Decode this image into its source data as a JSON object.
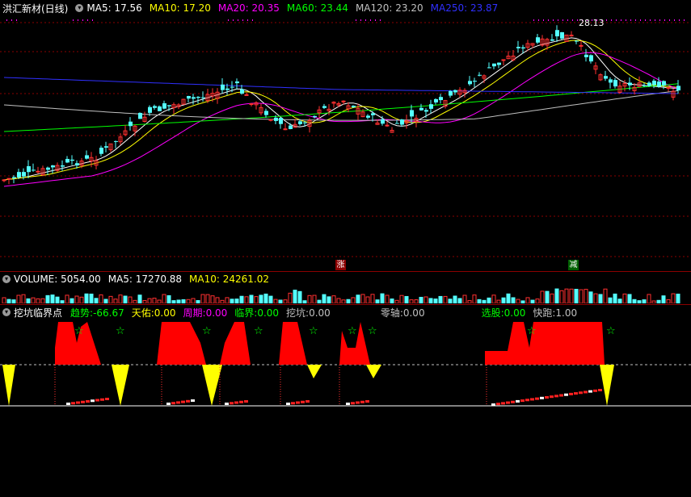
{
  "main": {
    "title": "洪汇新材(日线)",
    "ma": [
      {
        "label": "MA5: 17.56",
        "color": "#ffffff"
      },
      {
        "label": "MA10: 17.20",
        "color": "#ffff00"
      },
      {
        "label": "MA20: 20.35",
        "color": "#ff00ff"
      },
      {
        "label": "MA60: 23.44",
        "color": "#00ff00"
      },
      {
        "label": "MA120: 23.20",
        "color": "#c0c0c0"
      },
      {
        "label": "MA250: 23.87",
        "color": "#3030ff"
      }
    ],
    "high_label": "28.13",
    "tag_up": "涨",
    "tag_down": "减"
  },
  "volume": {
    "label": "VOLUME: 5054.00",
    "ma5": "MA5: 17270.88",
    "ma10": "MA10: 24261.02"
  },
  "indicator": {
    "name": "挖坑临界点",
    "items": [
      {
        "label": "趋势:",
        "value": "-66.67",
        "color": "#00ff00"
      },
      {
        "label": "天佑:",
        "value": "0.00",
        "color": "#ffff00"
      },
      {
        "label": "周期:",
        "value": "0.00",
        "color": "#ff00ff"
      },
      {
        "label": "临界:",
        "value": "0.00",
        "color": "#00ff00"
      },
      {
        "label": "挖坑:",
        "value": "0.00",
        "color": "#c0c0c0"
      },
      {
        "label": "零轴:",
        "value": "0.00",
        "color": "#c0c0c0"
      },
      {
        "label": "选股:",
        "value": "0.00",
        "color": "#00ff00"
      },
      {
        "label": "快跑:",
        "value": "1.00",
        "color": "#c0c0c0"
      }
    ],
    "star": "☆"
  },
  "colors": {
    "up": "#ff3030",
    "down": "#54ffff",
    "grid": "#8b0000"
  }
}
